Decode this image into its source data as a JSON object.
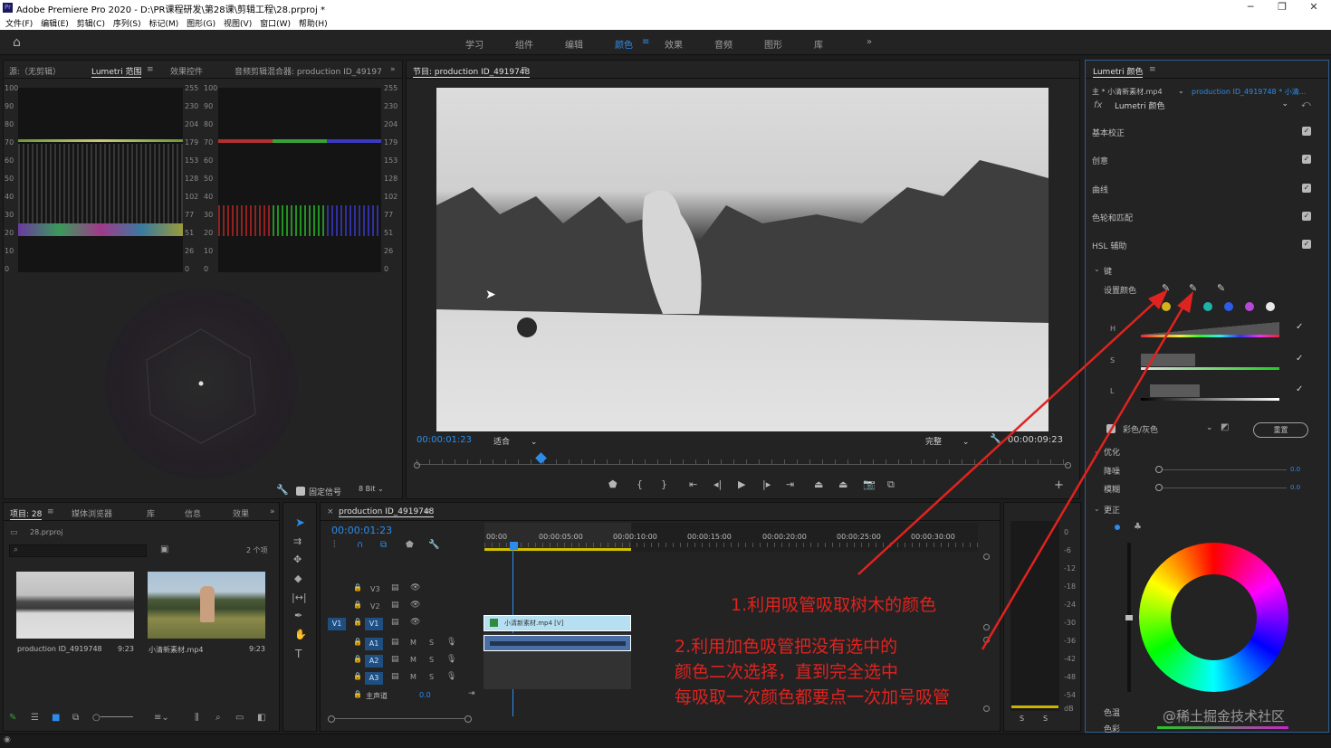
{
  "window": {
    "title": "Adobe Premiere Pro 2020 - D:\\PR课程研发\\第28课\\剪辑工程\\28.prproj *",
    "controls": [
      "─",
      "❐",
      "✕"
    ]
  },
  "menu": [
    "文件(F)",
    "编辑(E)",
    "剪辑(C)",
    "序列(S)",
    "标记(M)",
    "图形(G)",
    "视图(V)",
    "窗口(W)",
    "帮助(H)"
  ],
  "workspaces": {
    "items": [
      "学习",
      "组件",
      "编辑",
      "颜色",
      "效果",
      "音频",
      "图形",
      "库"
    ],
    "active": "颜色",
    "more": "»"
  },
  "source_panel": {
    "tabs": [
      "源:（无剪辑）",
      "Lumetri 范围",
      "效果控件",
      "音频剪辑混合器: production ID_49197"
    ],
    "scope_left_ticks": [
      "100",
      "90",
      "80",
      "70",
      "60",
      "50",
      "40",
      "30",
      "20",
      "10",
      "0"
    ],
    "scope_right_ticks": [
      "255",
      "230",
      "204",
      "179",
      "153",
      "128",
      "102",
      "77",
      "51",
      "26",
      "0"
    ],
    "clamp_label": "固定信号",
    "bit_depth": "8 Bit"
  },
  "program": {
    "title": "节目: production ID_4919748",
    "timecode": "00:00:01:23",
    "fit": "适合",
    "quality": "完整",
    "duration": "00:00:09:23",
    "playhead_fraction": 0.19
  },
  "project": {
    "tabs": [
      "项目: 28",
      "媒体浏览器",
      "库",
      "信息",
      "效果"
    ],
    "file": "28.prproj",
    "count": "2 个项",
    "items": [
      {
        "name": "production ID_4919748",
        "duration": "9:23"
      },
      {
        "name": "小清新素材.mp4",
        "duration": "9:23"
      }
    ]
  },
  "timeline": {
    "title": "production ID_4919748",
    "timecode": "00:00:01:23",
    "ruler": [
      "00:00",
      "00:00:05:00",
      "00:00:10:00",
      "00:00:15:00",
      "00:00:20:00",
      "00:00:25:00",
      "00:00:30:00"
    ],
    "tracks": [
      {
        "id": "V3",
        "kind": "video"
      },
      {
        "id": "V2",
        "kind": "video"
      },
      {
        "id": "V1",
        "kind": "video"
      },
      {
        "id": "A1",
        "kind": "audio"
      },
      {
        "id": "A2",
        "kind": "audio"
      },
      {
        "id": "A3",
        "kind": "audio"
      }
    ],
    "master_label": "主声道",
    "master_value": "0.0",
    "video_clip": "小清新素材.mp4 [V]"
  },
  "meter": {
    "ticks": [
      "0",
      "-6",
      "-12",
      "-18",
      "-24",
      "-30",
      "-36",
      "-42",
      "-48",
      "-54",
      "dB"
    ],
    "solo": [
      "S",
      "S"
    ]
  },
  "lumetri": {
    "title": "Lumetri 颜色",
    "master": "主 * 小清新素材.mp4",
    "sequence": "production ID_4919748 * 小清...",
    "effect": "Lumetri 颜色",
    "sections": [
      "基本校正",
      "创意",
      "曲线",
      "色轮和匹配",
      "HSL 辅助"
    ],
    "key_label": "键",
    "set_color": "设置颜色",
    "hsl": [
      "H",
      "S",
      "L"
    ],
    "mode": "彩色/灰色",
    "reset": "重置",
    "refine": "优化",
    "denoise": "降噪",
    "denoise_value": "0.0",
    "blur": "模糊",
    "blur_value": "0.0",
    "correction": "更正",
    "temp": "色温",
    "tint": "色彩",
    "swatches": [
      "#d4b21a",
      "#1fb3a8",
      "#2f5bea",
      "#b64ad6",
      "#e8e8e8"
    ]
  },
  "annotations": [
    "1.利用吸管吸取树木的颜色",
    "2.利用加色吸管把没有选中的",
    "颜色二次选择，直到完全选中",
    "每吸取一次颜色都要点一次加号吸管"
  ],
  "watermark": "@稀土掘金技术社区"
}
